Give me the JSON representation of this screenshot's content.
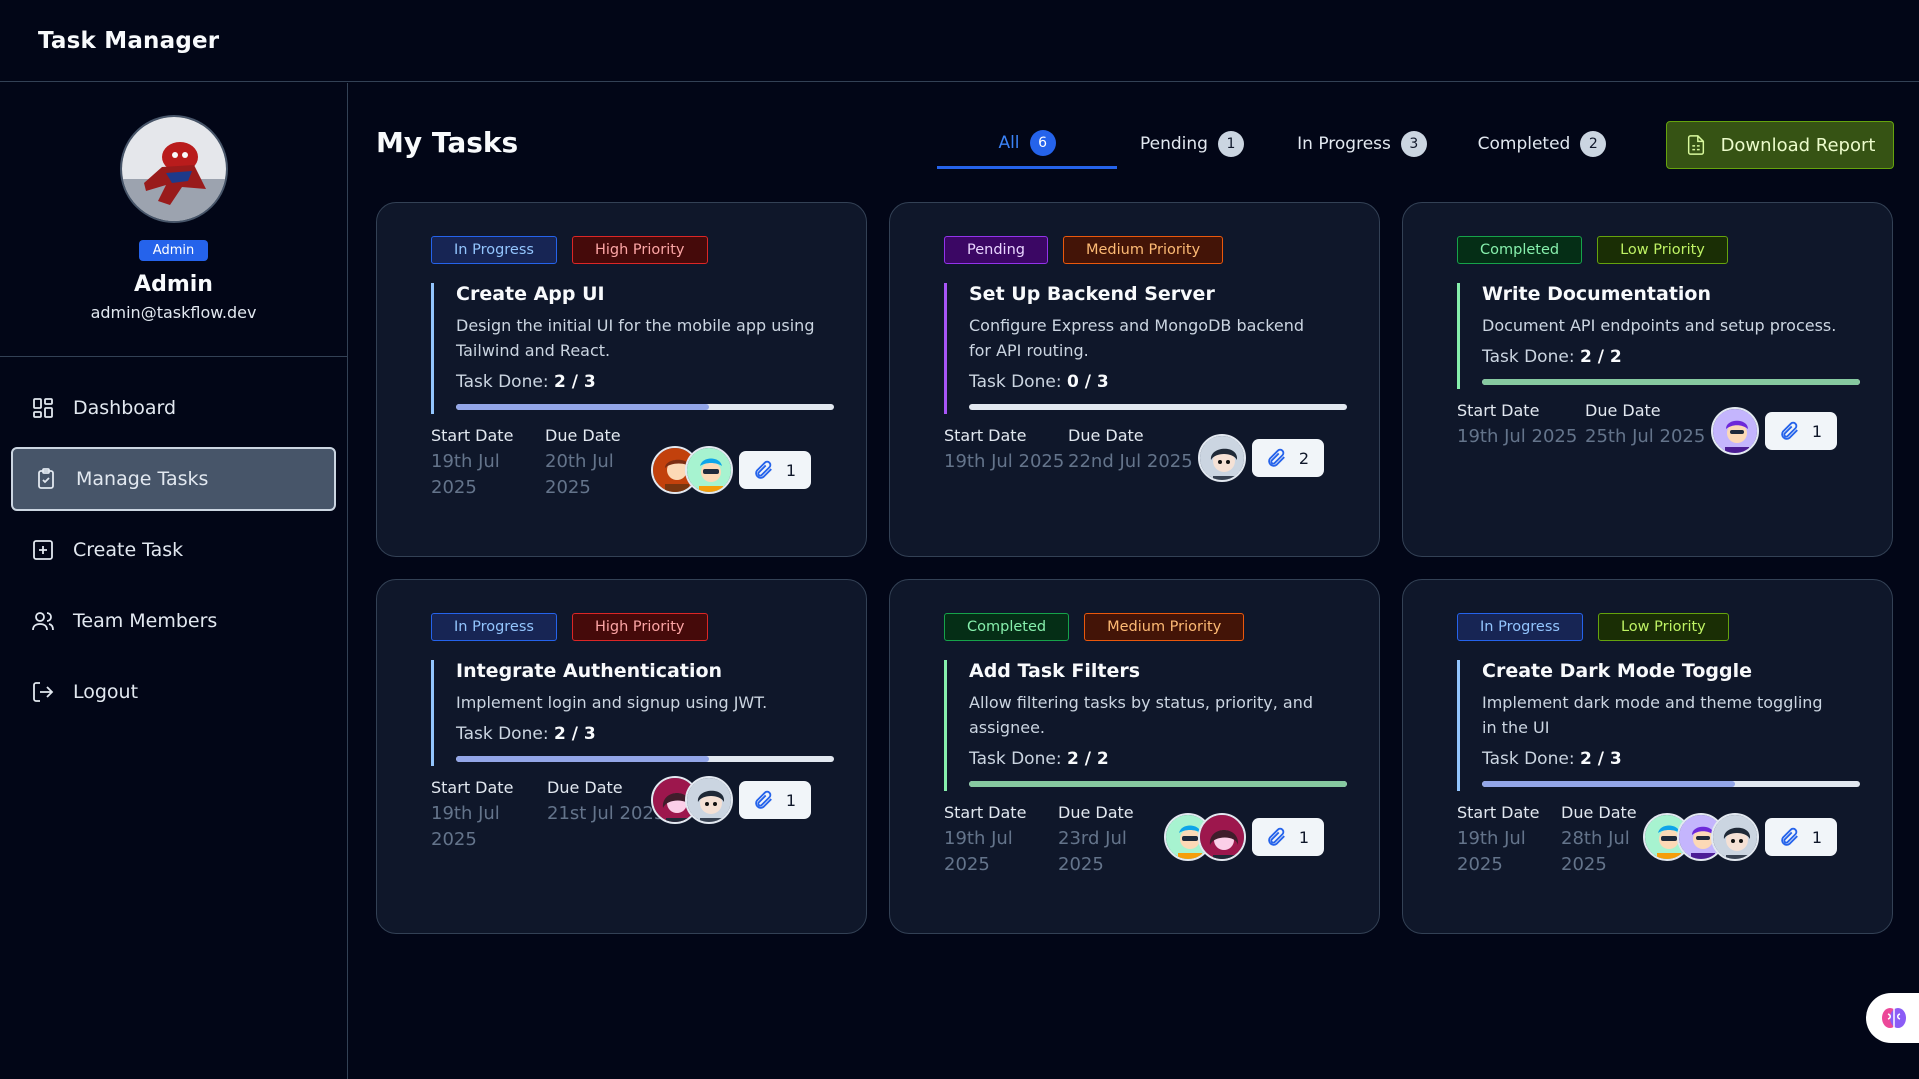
{
  "app": {
    "title": "Task Manager"
  },
  "profile": {
    "role": "Admin",
    "name": "Admin",
    "email": "admin@taskflow.dev"
  },
  "nav": [
    {
      "label": "Dashboard",
      "icon": "dashboard-icon"
    },
    {
      "label": "Manage Tasks",
      "icon": "clipboard-icon",
      "active": true
    },
    {
      "label": "Create Task",
      "icon": "plus-square-icon"
    },
    {
      "label": "Team Members",
      "icon": "users-icon"
    },
    {
      "label": "Logout",
      "icon": "logout-icon"
    }
  ],
  "page": {
    "title": "My Tasks"
  },
  "tabs": [
    {
      "label": "All",
      "count": "6",
      "active": true
    },
    {
      "label": "Pending",
      "count": "1"
    },
    {
      "label": "In Progress",
      "count": "3"
    },
    {
      "label": "Completed",
      "count": "2"
    }
  ],
  "download": {
    "label": "Download Report"
  },
  "labels": {
    "start": "Start Date",
    "due": "Due Date",
    "done": "Task Done:"
  },
  "colors": {
    "accent": "#2563eb",
    "progress_blue": "#93a6e8",
    "progress_purple": "#a855f7",
    "progress_green": "#86c9a0"
  },
  "tasks": [
    {
      "status": "In Progress",
      "priority": "High Priority",
      "title": "Create App UI",
      "description": "Design the initial UI for the mobile app using Tailwind and React.",
      "done": "2 / 3",
      "progress": 0.67,
      "start": "19th Jul 2025",
      "due": "20th Jul 2025",
      "attachments": "1"
    },
    {
      "status": "Pending",
      "priority": "Medium Priority",
      "title": "Set Up Backend Server",
      "description": "Configure Express and MongoDB backend for API routing.",
      "done": "0 / 3",
      "progress": 0.0,
      "start": "19th Jul 2025",
      "due": "22nd Jul 2025",
      "attachments": "2"
    },
    {
      "status": "Completed",
      "priority": "Low Priority",
      "title": "Write Documentation",
      "description": "Document API endpoints and setup process.",
      "done": "2 / 2",
      "progress": 1.0,
      "start": "19th Jul 2025",
      "due": "25th Jul 2025",
      "attachments": "1"
    },
    {
      "status": "In Progress",
      "priority": "High Priority",
      "title": "Integrate Authentication",
      "description": "Implement login and signup using JWT.",
      "done": "2 / 3",
      "progress": 0.67,
      "start": "19th Jul 2025",
      "due": "21st Jul 2025",
      "attachments": "1"
    },
    {
      "status": "Completed",
      "priority": "Medium Priority",
      "title": "Add Task Filters",
      "description": "Allow filtering tasks by status, priority, and assignee.",
      "done": "2 / 2",
      "progress": 1.0,
      "start": "19th Jul 2025",
      "due": "23rd Jul 2025",
      "attachments": "1"
    },
    {
      "status": "In Progress",
      "priority": "Low Priority",
      "title": "Create Dark Mode Toggle",
      "description": "Implement dark mode and theme toggling in the UI",
      "done": "2 / 3",
      "progress": 0.67,
      "start": "19th Jul 2025",
      "due": "28th Jul 2025",
      "attachments": "1"
    }
  ]
}
